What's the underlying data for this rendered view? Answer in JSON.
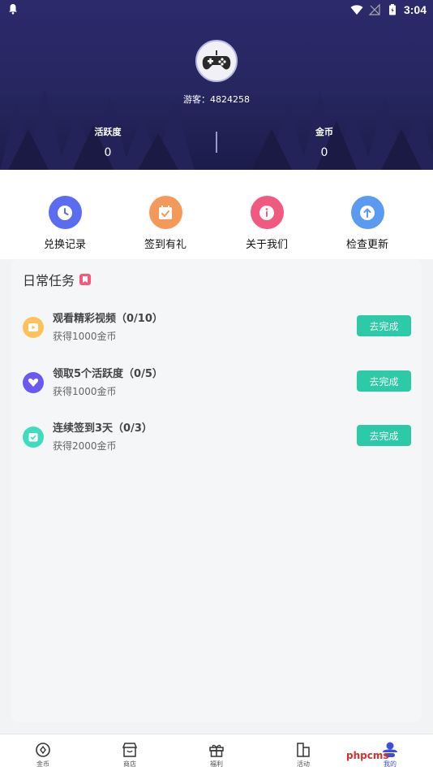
{
  "status_bar": {
    "time": "3:04"
  },
  "profile": {
    "user_id": "游客：4824258"
  },
  "stats": [
    {
      "label": "活跃度",
      "value": "0"
    },
    {
      "label": "金币",
      "value": "0"
    }
  ],
  "quick_actions": [
    {
      "label": "兑换记录",
      "icon": "clock-icon",
      "color": "#5a6cf0"
    },
    {
      "label": "签到有礼",
      "icon": "checkin-icon",
      "color": "#f39a5a"
    },
    {
      "label": "关于我们",
      "icon": "info-icon",
      "color": "#f05a7e"
    },
    {
      "label": "检查更新",
      "icon": "upload-icon",
      "color": "#5a9af0"
    }
  ],
  "daily_tasks": {
    "title": "日常任务",
    "button_label": "去完成",
    "tasks": [
      {
        "name": "观看精彩视频（0/10）",
        "reward": "获得1000金币",
        "icon": "video-icon",
        "color": "#ffc15a"
      },
      {
        "name": "领取5个活跃度（0/5）",
        "reward": "获得1000金币",
        "icon": "heart-icon",
        "color": "#6a5af0"
      },
      {
        "name": "连续签到3天（0/3）",
        "reward": "获得2000金币",
        "icon": "calendar-check-icon",
        "color": "#3fdcc0"
      }
    ]
  },
  "bottom_nav": [
    {
      "label": "金币",
      "icon": "coin-icon"
    },
    {
      "label": "商店",
      "icon": "shop-icon"
    },
    {
      "label": "福利",
      "icon": "gift-icon"
    },
    {
      "label": "活动",
      "icon": "flag-icon"
    },
    {
      "label": "我的",
      "icon": "user-icon"
    }
  ],
  "watermark": "phpcms"
}
